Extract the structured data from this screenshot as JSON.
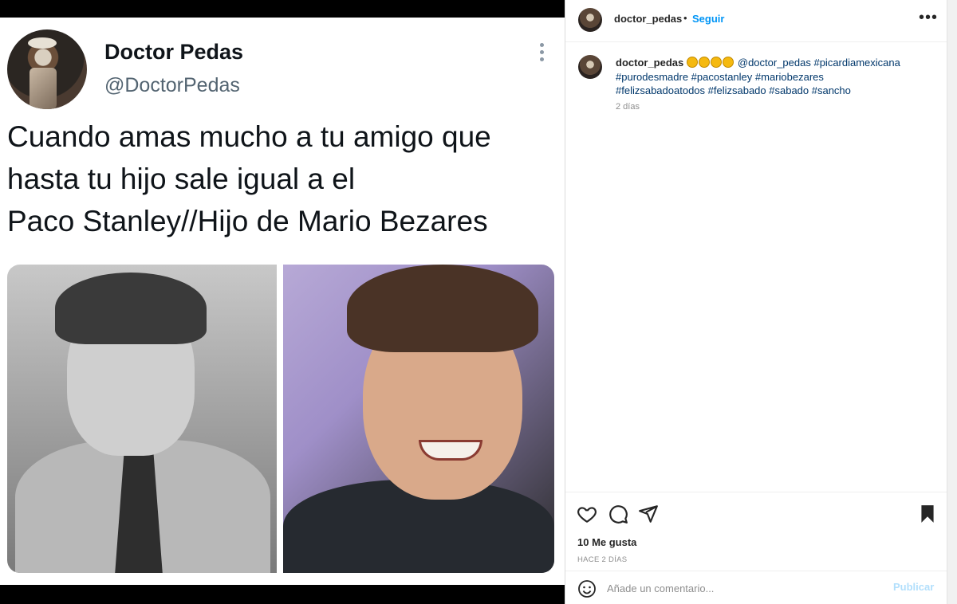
{
  "tweet": {
    "name": "Doctor Pedas",
    "handle": "@DoctorPedas",
    "text_lines": [
      "Cuando amas mucho a tu amigo que",
      "hasta tu hijo sale igual a el",
      "Paco Stanley//Hijo de Mario Bezares"
    ]
  },
  "post": {
    "username": "doctor_pedas",
    "separator": "•",
    "follow_label": "Seguir",
    "more_label": "•••",
    "caption_user": "doctor_pedas",
    "caption_tags_line1": "@doctor_pedas #picardiamexicana",
    "caption_tags_line2": "#purodesmadre #pacostanley #mariobezares",
    "caption_tags_line3": "#felizsabadoatodos #felizsabado #sabado #sancho",
    "caption_time": "2 días",
    "likes": "10 Me gusta",
    "time_ago": "HACE 2 DÍAS",
    "comment_placeholder": "Añade un comentario...",
    "publish_label": "Publicar"
  },
  "icons": [
    "heart-icon",
    "comment-icon",
    "share-icon",
    "bookmark-icon",
    "emoji-icon",
    "more-icon"
  ],
  "colors": {
    "follow": "#0095f6",
    "publish_disabled": "#b2dffc",
    "hashtag": "#00376b"
  }
}
